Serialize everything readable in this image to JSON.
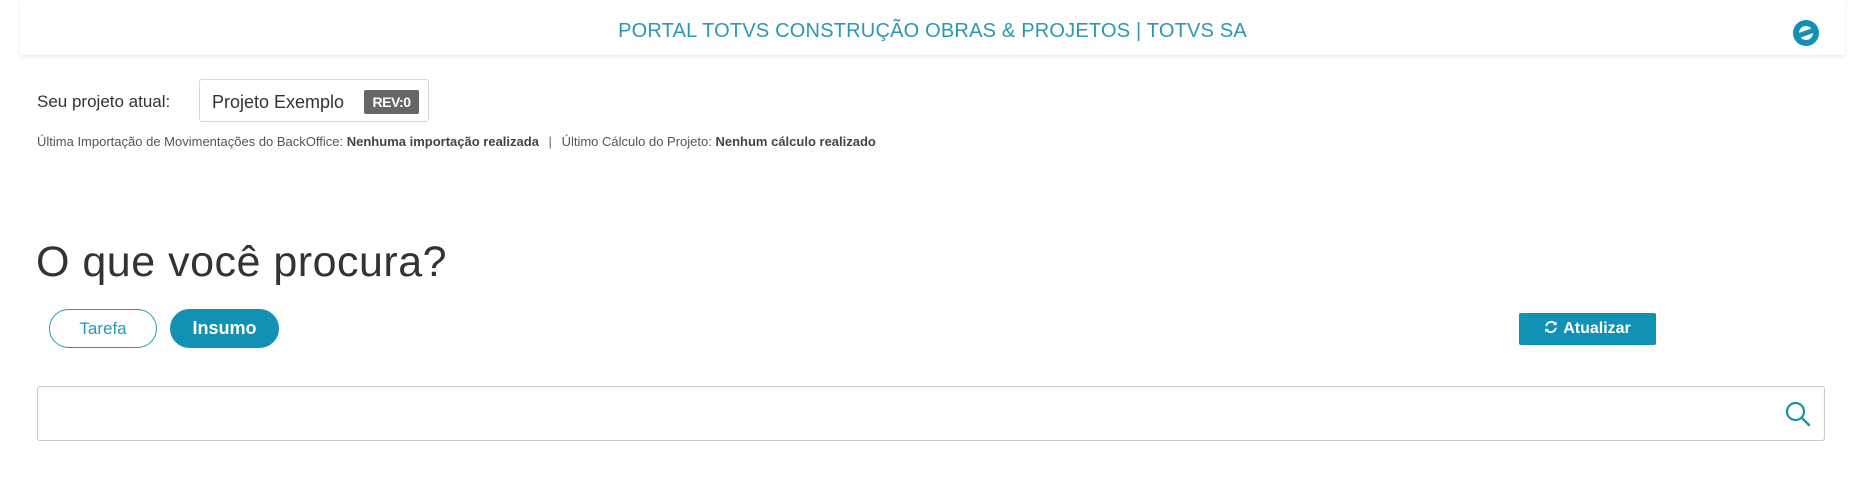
{
  "header": {
    "title": "PORTAL TOTVS CONSTRUÇÃO OBRAS & PROJETOS | TOTVS SA",
    "logo_icon": "totvs-logo-icon",
    "accent_color": "#2a98b5"
  },
  "project": {
    "label": "Seu projeto atual:",
    "name": "Projeto Exemplo",
    "revision": "REV:0"
  },
  "info": {
    "import_label": "Última Importação de Movimentações do BackOffice:",
    "import_value": "Nenhuma importação realizada",
    "separator": "|",
    "calc_label": "Último Cálculo do Projeto:",
    "calc_value": "Nenhum cálculo realizado"
  },
  "search": {
    "heading": "O que você procura?",
    "filters": [
      {
        "label": "Tarefa",
        "selected": false
      },
      {
        "label": "Insumo",
        "selected": true
      }
    ],
    "refresh_label": "Atualizar",
    "refresh_icon": "refresh-icon",
    "input_value": "",
    "input_placeholder": "",
    "search_icon": "search-icon",
    "button_color": "#1191b4"
  }
}
